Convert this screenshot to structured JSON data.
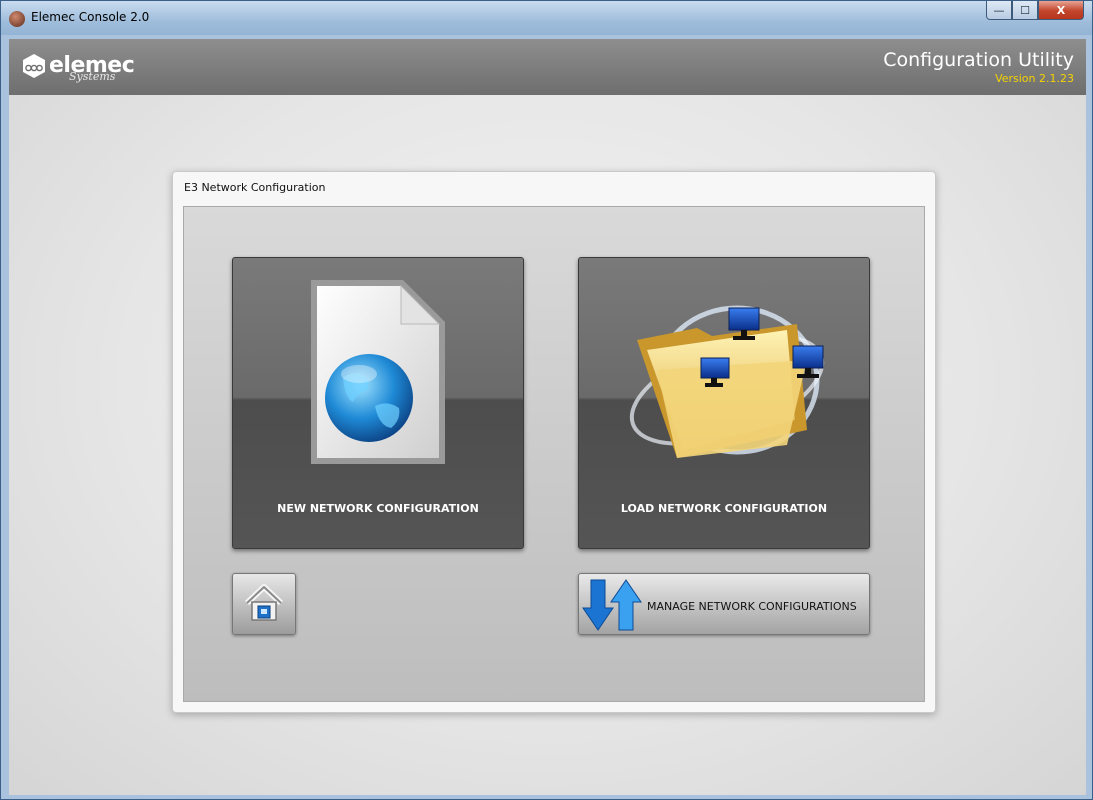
{
  "window": {
    "title": "Elemec Console 2.0",
    "min_glyph": "—",
    "max_glyph": "☐",
    "close_glyph": "X"
  },
  "header": {
    "logo_name": "elemec",
    "logo_sub": "Systems",
    "app_title": "Configuration Utility",
    "version": "Version 2.1.23"
  },
  "panel": {
    "title": "E3 Network Configuration",
    "new_label": "NEW NETWORK CONFIGURATION",
    "load_label": "LOAD NETWORK CONFIGURATION",
    "manage_label": "MANAGE NETWORK CONFIGURATIONS"
  },
  "colors": {
    "version": "#f5d300",
    "header": "#7a7a7a",
    "tile": "#5a5a5a"
  }
}
